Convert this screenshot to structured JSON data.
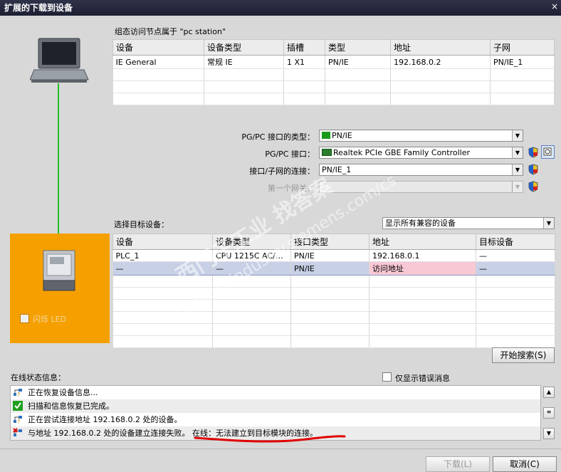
{
  "window": {
    "title": "扩展的下载到设备",
    "close": "×"
  },
  "config_access": {
    "heading": "组态访问节点属于 \"pc station\"",
    "columns": [
      "设备",
      "设备类型",
      "插槽",
      "类型",
      "地址",
      "子网"
    ],
    "rows": [
      [
        "IE General",
        "常规 IE",
        "1 X1",
        "PN/IE",
        "192.168.0.2",
        "PN/IE_1"
      ]
    ]
  },
  "interface": {
    "pgpc_type_label": "PG/PC 接口的类型：",
    "pgpc_type_value": "PN/IE",
    "pgpc_iface_label": "PG/PC 接口：",
    "pgpc_iface_value": "Realtek PCIe GBE Family Controller",
    "subnet_label": "接口/子网的连接：",
    "subnet_value": "PN/IE_1",
    "gateway_label": "第一个网关：",
    "gateway_value": ""
  },
  "target": {
    "heading": "选择目标设备：",
    "filter_value": "显示所有兼容的设备",
    "columns": [
      "设备",
      "设备类型",
      "接口类型",
      "地址",
      "目标设备"
    ],
    "rows": [
      [
        "PLC_1",
        "CPU 1215C AC/D...",
        "PN/IE",
        "192.168.0.1",
        "—"
      ],
      [
        "—",
        "—",
        "PN/IE",
        "访问地址",
        "—"
      ]
    ]
  },
  "left_panel": {
    "flash_led": "闪烁 LED"
  },
  "search_button": "开始搜索(S)",
  "status": {
    "heading": "在线状态信息：",
    "only_errors": "仅显示错误消息",
    "messages": [
      {
        "icon": "network-info-icon",
        "text": "正在恢复设备信息..."
      },
      {
        "icon": "check-icon",
        "text": "扫描和信息恢复已完成。"
      },
      {
        "icon": "network-info-icon",
        "text": "正在尝试连接地址 192.168.0.2 处的设备。"
      },
      {
        "icon": "network-error-icon",
        "text": "与地址 192.168.0.2 处的设备建立连接失败。 在线：无法建立到目标模块的连接。"
      }
    ]
  },
  "footer": {
    "download": "下载(L)",
    "cancel": "取消(C)"
  },
  "watermark": {
    "line1": "西门子工业 找答案",
    "line2": "support.industry.siemens.com/cs"
  },
  "colors": {
    "title_bg": "#24263a",
    "orange": "#f5a000",
    "green_line": "#22c022",
    "selected_row": "#c8d0e6",
    "pink_cell": "#f8c8d4",
    "red_underline": "#e00000"
  }
}
